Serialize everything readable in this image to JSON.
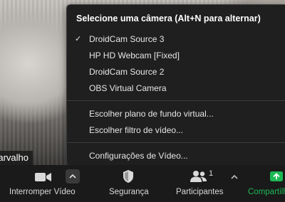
{
  "participant": {
    "name_fragment": "arvalho"
  },
  "camera_menu": {
    "header": "Selecione uma câmera (Alt+N para alternar)",
    "cameras": [
      {
        "label": "DroidCam Source 3",
        "selected": true
      },
      {
        "label": "HP HD Webcam [Fixed]",
        "selected": false
      },
      {
        "label": "DroidCam Source 2",
        "selected": false
      },
      {
        "label": "OBS Virtual Camera",
        "selected": false
      }
    ],
    "checkmark": "✓",
    "actions": [
      {
        "label": "Escolher plano de fundo virtual..."
      },
      {
        "label": "Escolher filtro de vídeo..."
      }
    ],
    "settings_label": "Configurações de Vídeo..."
  },
  "toolbar": {
    "stop_video_label": "Interromper Vídeo",
    "security_label": "Segurança",
    "participants_label": "Participantes",
    "participants_count": "1",
    "share_label": "Compartilhar",
    "accent_green": "#1db954",
    "icons": {
      "video": "video-camera-icon",
      "security": "shield-icon",
      "participants": "participants-icon",
      "share": "share-screen-icon"
    }
  }
}
